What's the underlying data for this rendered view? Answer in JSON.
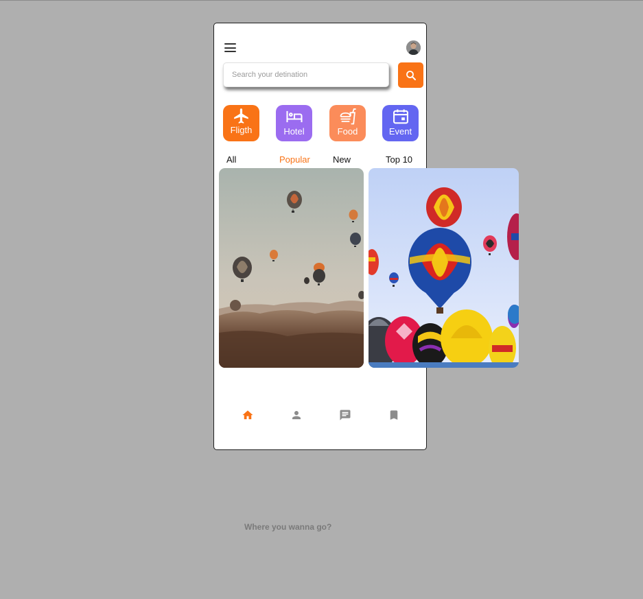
{
  "search": {
    "placeholder": "Search your detination"
  },
  "categories": [
    {
      "label": "Fligth",
      "color": "#f97316",
      "icon": "airplane-icon"
    },
    {
      "label": "Hotel",
      "color": "#9b6cf0",
      "icon": "bed-icon"
    },
    {
      "label": "Food",
      "color": "#fb8c5a",
      "icon": "fastfood-icon"
    },
    {
      "label": "Event",
      "color": "#6366f1",
      "icon": "calendar-icon"
    }
  ],
  "tabs": [
    {
      "label": "All"
    },
    {
      "label": "Popular",
      "active": true
    },
    {
      "label": "New"
    },
    {
      "label": "Top 10"
    }
  ],
  "cards": [
    {
      "name": "desert-balloons-photo"
    },
    {
      "name": "colorful-balloons-photo"
    }
  ],
  "bottom_nav": [
    {
      "icon": "home-icon",
      "active": true
    },
    {
      "icon": "person-icon"
    },
    {
      "icon": "chat-icon"
    },
    {
      "icon": "bookmark-icon"
    }
  ],
  "footer": {
    "text": "Where you wanna go?"
  },
  "colors": {
    "accent": "#f97316",
    "inactive_icon": "#8c8c8c"
  }
}
